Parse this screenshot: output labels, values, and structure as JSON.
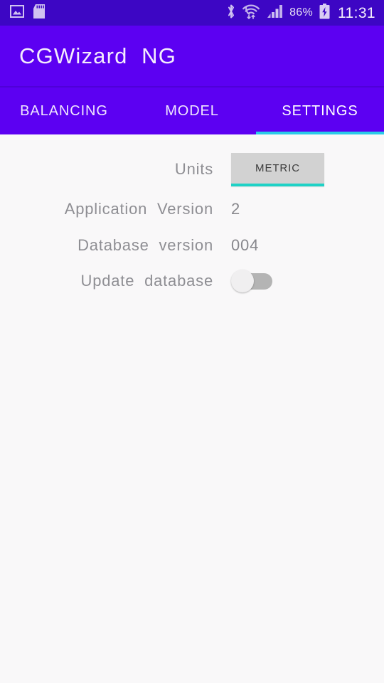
{
  "status_bar": {
    "icons_left": [
      "image-icon",
      "sd-card-icon"
    ],
    "icons_right": [
      "bluetooth-icon",
      "wifi-icon",
      "cellular-signal-icon",
      "battery-charging-icon"
    ],
    "battery_percent": "86%",
    "clock": "11:31"
  },
  "app_bar": {
    "title": "CGWizard  NG"
  },
  "tabs": [
    {
      "label": "BALANCING",
      "active": false
    },
    {
      "label": "MODEL",
      "active": false
    },
    {
      "label": "SETTINGS",
      "active": true
    }
  ],
  "settings": {
    "units": {
      "label": "Units",
      "value": "METRIC",
      "options": [
        "METRIC"
      ]
    },
    "application_version": {
      "label": "Application  Version",
      "value": "2"
    },
    "database_version": {
      "label": "Database  version",
      "value": "004"
    },
    "update_database": {
      "label": "Update  database",
      "value": "off"
    }
  },
  "colors": {
    "status_bar": "#3d06c4",
    "app_bar": "#5c00f2",
    "tab_indicator": "#29cbe8",
    "spinner_underline": "#1fd2c6",
    "content_background": "#f9f8f9",
    "label_text": "#8e8e93"
  }
}
